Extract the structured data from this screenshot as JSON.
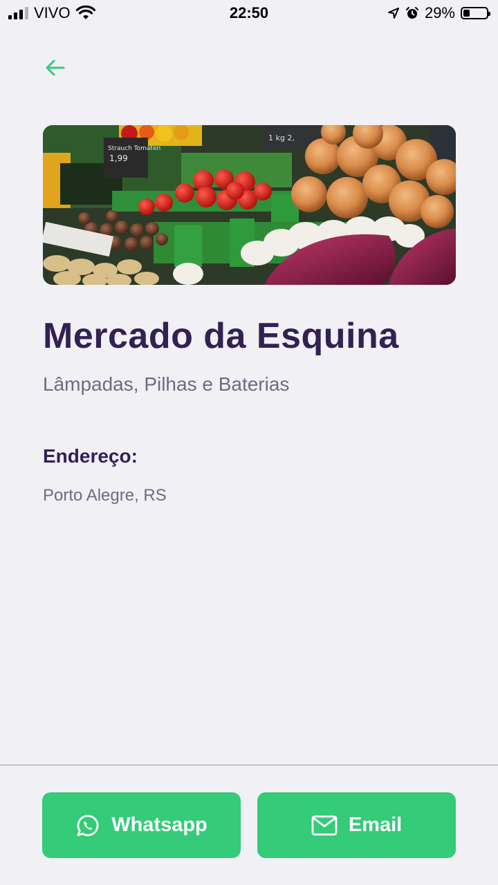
{
  "status_bar": {
    "carrier": "VIVO",
    "time": "22:50",
    "battery_percent": "29%",
    "battery_level": 0.29,
    "signal_bars": 3
  },
  "back": {
    "icon": "arrow-left-icon"
  },
  "point": {
    "name": "Mercado da Esquina",
    "items": "Lâmpadas, Pilhas e Baterias",
    "address_label": "Endereço:",
    "address": "Porto Alegre, RS"
  },
  "footer": {
    "whatsapp_label": "Whatsapp",
    "whatsapp_icon": "whatsapp-icon",
    "email_label": "Email",
    "email_icon": "mail-icon"
  },
  "colors": {
    "background": "#f0f0f5",
    "title": "#322153",
    "text": "#6c6c80",
    "accent": "#34cb79"
  }
}
